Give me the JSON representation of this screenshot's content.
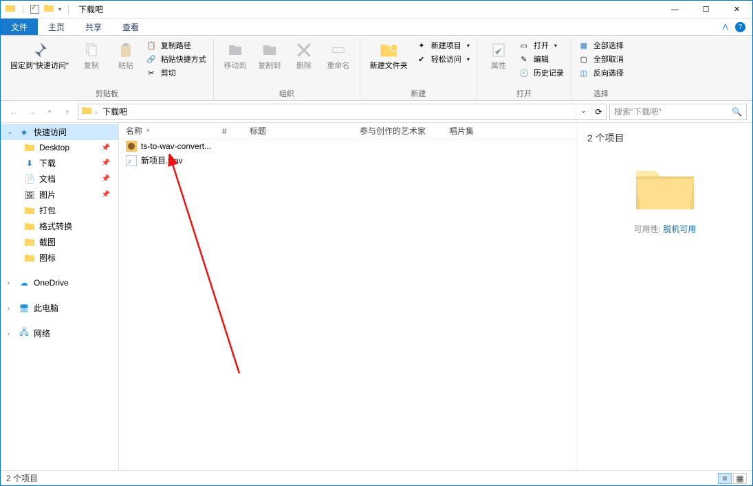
{
  "window": {
    "title": "下载吧",
    "minimize": "—",
    "maximize": "☐",
    "close": "✕"
  },
  "tabs": {
    "file": "文件",
    "home": "主页",
    "share": "共享",
    "view": "查看"
  },
  "ribbon": {
    "clipboard": {
      "label": "剪贴板",
      "pin": "固定到\"快速访问\"",
      "copy": "复制",
      "paste": "粘贴",
      "copy_path": "复制路径",
      "paste_shortcut": "粘贴快捷方式",
      "cut": "剪切"
    },
    "organize": {
      "label": "组织",
      "move_to": "移动到",
      "copy_to": "复制到",
      "delete": "删除",
      "rename": "重命名"
    },
    "new": {
      "label": "新建",
      "new_folder": "新建文件夹",
      "new_item": "新建项目",
      "easy_access": "轻松访问"
    },
    "open": {
      "label": "打开",
      "properties": "属性",
      "open": "打开",
      "edit": "编辑",
      "history": "历史记录"
    },
    "select": {
      "label": "选择",
      "select_all": "全部选择",
      "select_none": "全部取消",
      "invert": "反向选择"
    }
  },
  "nav": {
    "crumb": "下载吧",
    "search_placeholder": "搜索\"下载吧\""
  },
  "sidebar": {
    "quick_access": "快速访问",
    "desktop": "Desktop",
    "downloads": "下载",
    "documents": "文档",
    "pictures": "图片",
    "dabao": "打包",
    "format_convert": "格式转换",
    "screenshot": "截图",
    "icon": "图标",
    "onedrive": "OneDrive",
    "this_pc": "此电脑",
    "network": "网络"
  },
  "columns": {
    "name": "名称",
    "num": "#",
    "title": "标题",
    "artist": "参与创作的艺术家",
    "album": "唱片集"
  },
  "files": [
    {
      "name": "ts-to-wav-convert..."
    },
    {
      "name": "新项目.wav"
    }
  ],
  "details": {
    "count": "2 个项目",
    "avail_label": "可用性:",
    "avail_value": "脱机可用"
  },
  "status": {
    "text": "2 个项目"
  }
}
